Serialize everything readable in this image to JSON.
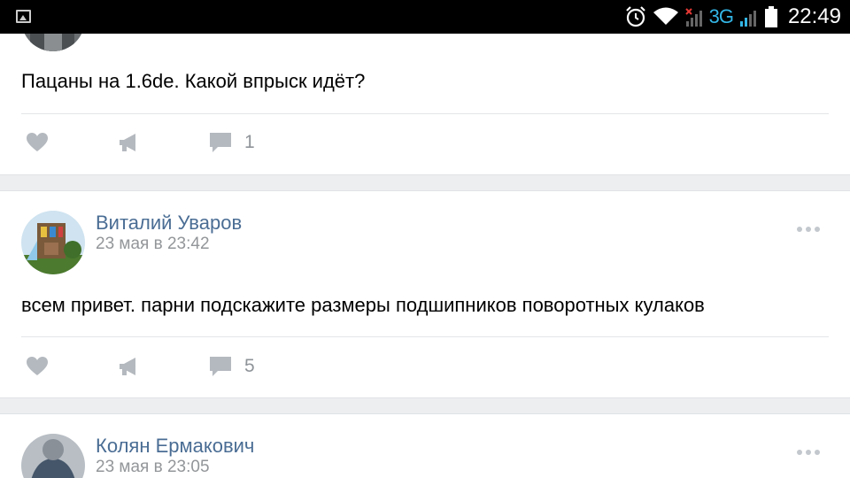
{
  "status_bar": {
    "network": "3G",
    "time": "22:49"
  },
  "posts": [
    {
      "text": "Пацаны на 1.6de. Какой впрыск идёт?",
      "comments": "1"
    },
    {
      "author": "Виталий Уваров",
      "date": "23 мая в 23:42",
      "text": "всем привет. парни подскажите размеры подшипников поворотных кулаков",
      "comments": "5"
    },
    {
      "author": "Колян Ермакович",
      "date": "23 мая в 23:05"
    }
  ],
  "colors": {
    "author": "#4a6d94",
    "meta": "#939699",
    "icon": "#b4b9bf",
    "background": "#edeef0",
    "network_accent": "#33b5e5"
  }
}
